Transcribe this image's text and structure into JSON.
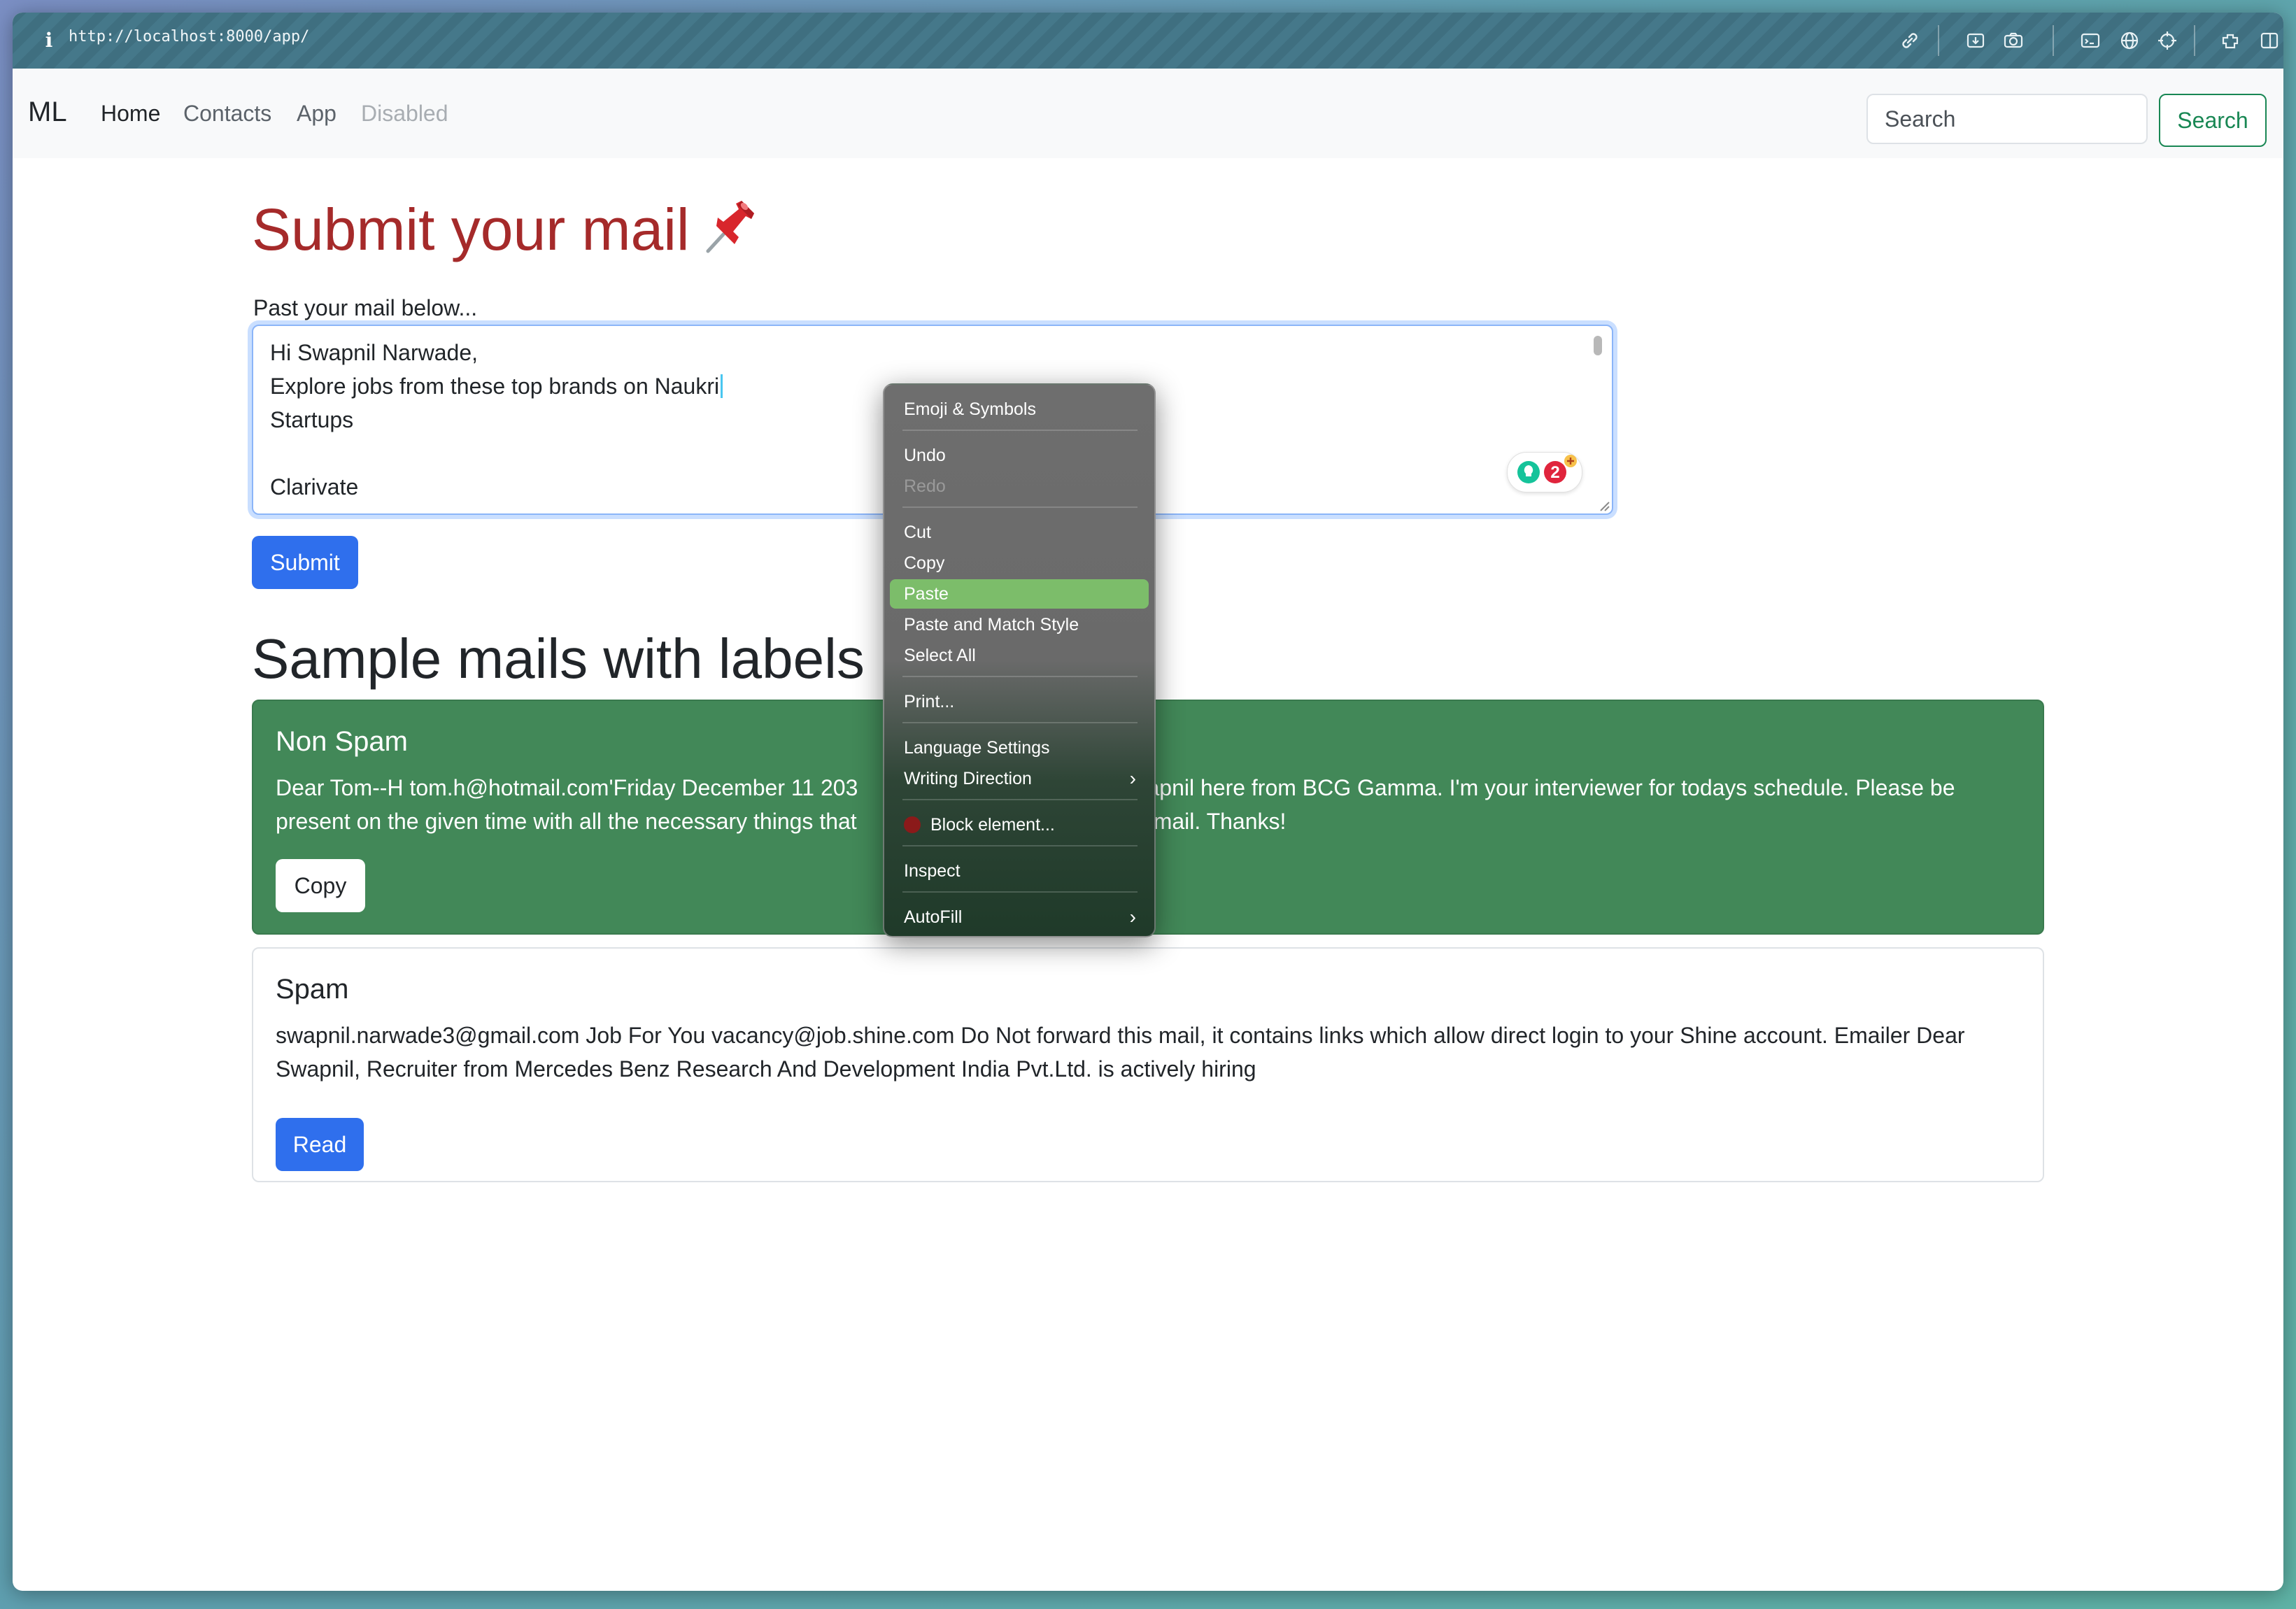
{
  "browser": {
    "url": "http://localhost:8000/app/"
  },
  "navbar": {
    "brand": "ML",
    "links": [
      "Home",
      "Contacts",
      "App",
      "Disabled"
    ],
    "search_placeholder": "Search",
    "search_button": "Search"
  },
  "main": {
    "title": "Submit your mail",
    "lead": "Past your mail below...",
    "mail_lines": [
      "Hi Swapnil Narwade,",
      "Explore jobs from these top brands on Naukri",
      "Startups",
      "",
      "Clarivate"
    ],
    "grammarly_count": "2",
    "submit_label": "Submit",
    "samples_heading": "Sample mails with labels"
  },
  "cards": {
    "nonspam": {
      "title": "Non Spam",
      "text_part1": "Dear Tom--H tom.h@hotmail.com'Friday December 11 203",
      "text_part2": "wapnil here from BCG Gamma. I'm your interviewer for todays schedule. Please be",
      "text_part3": "present on the given time with all the necessary things that",
      "text_part4": "is mail. Thanks!",
      "button": "Copy"
    },
    "spam": {
      "title": "Spam",
      "text": "swapnil.narwade3@gmail.com Job For You vacancy@job.shine.com Do Not forward this mail, it contains links which allow direct login to your Shine account. Emailer Dear Swapnil, Recruiter from Mercedes Benz Research And Development India Pvt.Ltd. is actively hiring",
      "button": "Read"
    }
  },
  "context_menu": {
    "emoji": "Emoji & Symbols",
    "undo": "Undo",
    "redo": "Redo",
    "cut": "Cut",
    "copy": "Copy",
    "paste": "Paste",
    "paste_match": "Paste and Match Style",
    "select_all": "Select All",
    "print": "Print...",
    "language": "Language Settings",
    "writing_direction": "Writing Direction",
    "block_element": "Block element...",
    "inspect": "Inspect",
    "autofill": "AutoFill"
  },
  "colors": {
    "title": "#a52a2a",
    "primary": "#2f6fed",
    "success": "#198754",
    "nonspam_card": "#428858",
    "menu_highlight": "#7cbd6a"
  }
}
